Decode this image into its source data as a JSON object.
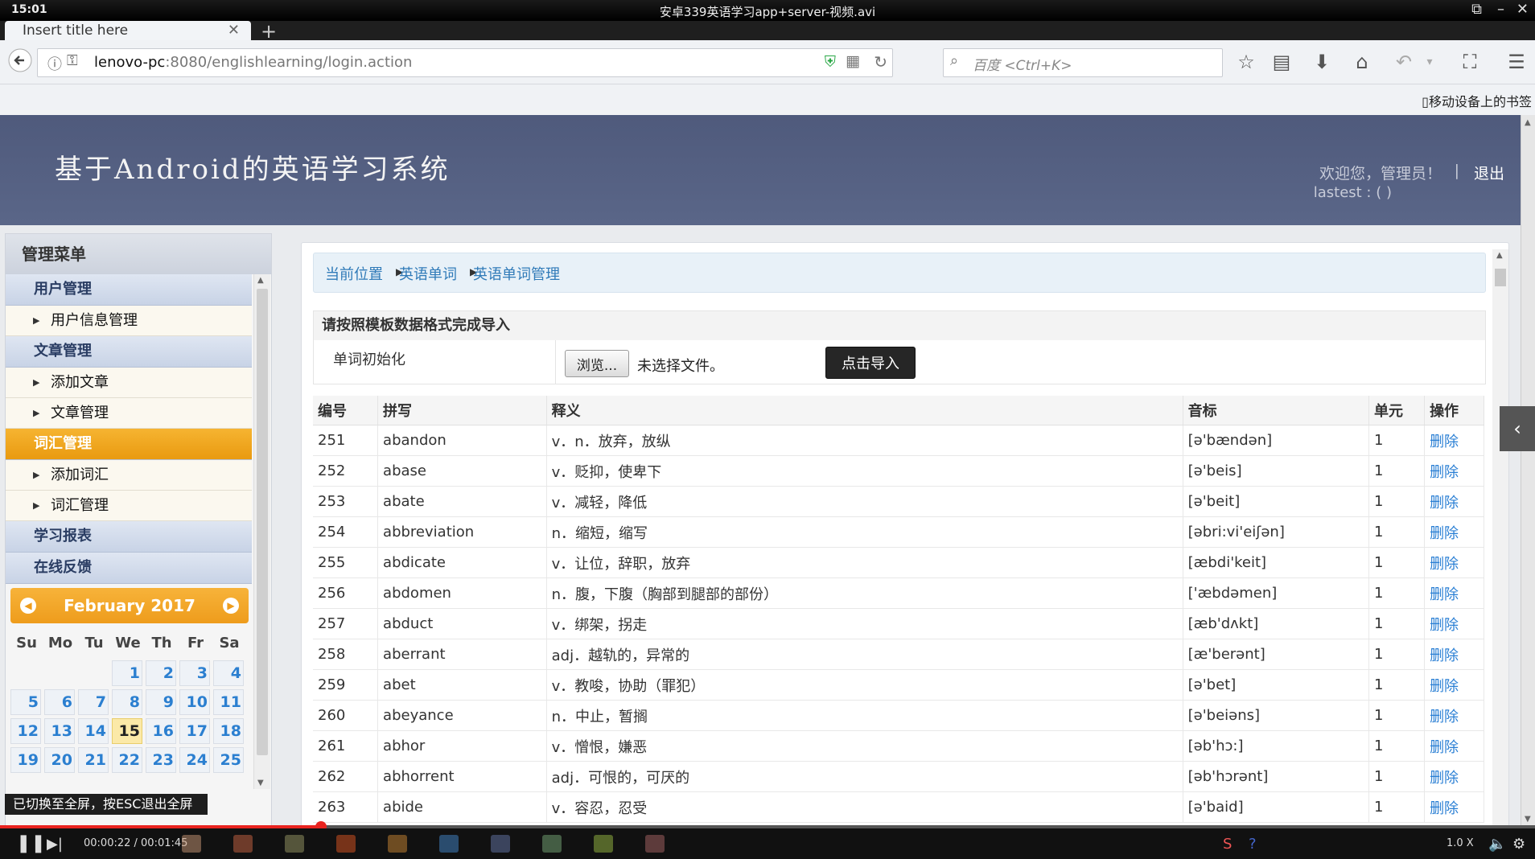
{
  "player": {
    "clock": "15:01",
    "video_title": "安卓339英语学习app+server-视频.avi",
    "time": "00:00:22 / 00:01:45",
    "progress": 0.2095,
    "speed": "1.0 X",
    "esc_tip": "已切换至全屏，按ESC退出全屏"
  },
  "browser": {
    "tab_title": "Insert title here",
    "url_host": "lenovo-pc",
    "url_rest": ":8080/englishlearning/login.action",
    "search_placeholder": "百度 <Ctrl+K>",
    "mobile_bookmarks": "移动设备上的书签"
  },
  "header": {
    "title": "基于Android的英语学习系统",
    "welcome": "欢迎您，管理员！",
    "separator": "|",
    "logout": "退出",
    "lastest": "lastest : ( )"
  },
  "sidebar": {
    "title": "管理菜单",
    "categories": [
      {
        "label": "用户管理",
        "active": false,
        "subs": [
          "用户信息管理"
        ]
      },
      {
        "label": "文章管理",
        "active": false,
        "subs": [
          "添加文章",
          "文章管理"
        ]
      },
      {
        "label": "词汇管理",
        "active": true,
        "subs": [
          "添加词汇",
          "词汇管理"
        ]
      },
      {
        "label": "学习报表",
        "active": false,
        "subs": []
      },
      {
        "label": "在线反馈",
        "active": false,
        "subs": []
      }
    ]
  },
  "calendar": {
    "month": "February 2017",
    "weekdays": [
      "Su",
      "Mo",
      "Tu",
      "We",
      "Th",
      "Fr",
      "Sa"
    ],
    "weeks": [
      [
        "",
        "",
        "",
        "1",
        "2",
        "3",
        "4"
      ],
      [
        "5",
        "6",
        "7",
        "8",
        "9",
        "10",
        "11"
      ],
      [
        "12",
        "13",
        "14",
        "15",
        "16",
        "17",
        "18"
      ],
      [
        "19",
        "20",
        "21",
        "22",
        "23",
        "24",
        "25"
      ]
    ],
    "today": "15"
  },
  "breadcrumb": [
    "当前位置",
    "英语单词",
    "英语单词管理"
  ],
  "import": {
    "heading": "请按照模板数据格式完成导入",
    "label": "单词初始化",
    "browse": "浏览...",
    "file_status": "未选择文件。",
    "submit": "点击导入"
  },
  "table": {
    "columns": [
      "编号",
      "拼写",
      "释义",
      "音标",
      "单元",
      "操作"
    ],
    "rows": [
      [
        "251",
        "abandon",
        "v．n．放弃，放纵",
        "[ə'bændən]",
        "1",
        "删除"
      ],
      [
        "252",
        "abase",
        "v．贬抑，使卑下",
        "[ə'beis]",
        "1",
        "删除"
      ],
      [
        "253",
        "abate",
        "v．减轻，降低",
        "[ə'beit]",
        "1",
        "删除"
      ],
      [
        "254",
        "abbreviation",
        "n．缩短，缩写",
        "[əbri:vi'eiʃən]",
        "1",
        "删除"
      ],
      [
        "255",
        "abdicate",
        "v．让位，辞职，放弃",
        "[æbdi'keit]",
        "1",
        "删除"
      ],
      [
        "256",
        "abdomen",
        "n．腹，下腹（胸部到腿部的部份）",
        "['æbdəmen]",
        "1",
        "删除"
      ],
      [
        "257",
        "abduct",
        "v．绑架，拐走",
        "[æb'dʌkt]",
        "1",
        "删除"
      ],
      [
        "258",
        "aberrant",
        "adj．越轨的，异常的",
        "[æ'berənt]",
        "1",
        "删除"
      ],
      [
        "259",
        "abet",
        "v．教唆，协助（罪犯）",
        "[ə'bet]",
        "1",
        "删除"
      ],
      [
        "260",
        "abeyance",
        "n．中止，暂搁",
        "[ə'beiəns]",
        "1",
        "删除"
      ],
      [
        "261",
        "abhor",
        "v．憎恨，嫌恶",
        "[əb'hɔ:]",
        "1",
        "删除"
      ],
      [
        "262",
        "abhorrent",
        "adj．可恨的，可厌的",
        "[əb'hɔrənt]",
        "1",
        "删除"
      ],
      [
        "263",
        "abide",
        "v．容忍，忍受",
        "[ə'baid]",
        "1",
        "删除"
      ]
    ]
  }
}
